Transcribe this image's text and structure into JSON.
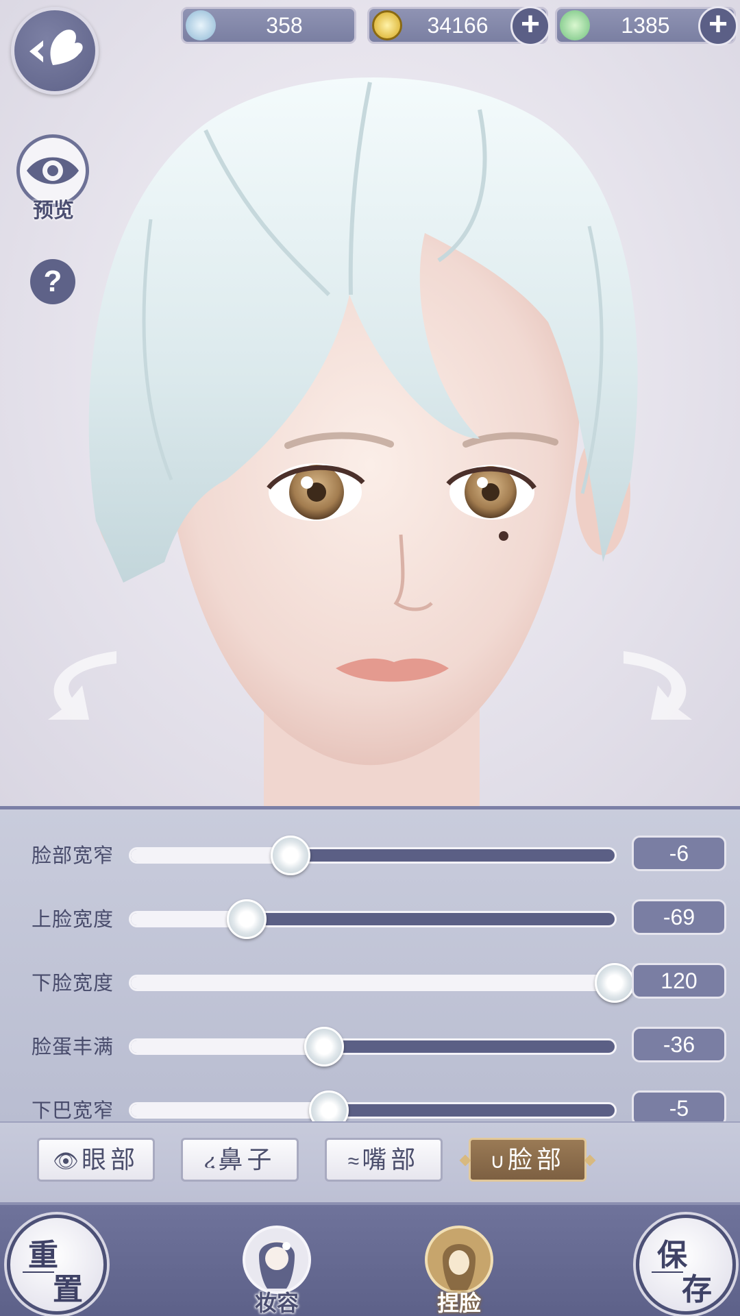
{
  "currencies": [
    {
      "value": "358",
      "icon": "feather-token-icon",
      "has_plus": false
    },
    {
      "value": "34166",
      "icon": "gold-coin-icon",
      "has_plus": true
    },
    {
      "value": "1385",
      "icon": "jade-token-icon",
      "has_plus": true
    }
  ],
  "left_controls": {
    "preview_label": "预览",
    "help_symbol": "?"
  },
  "sliders": [
    {
      "label": "脸部宽窄",
      "value": "-6",
      "level": 0.33
    },
    {
      "label": "上脸宽度",
      "value": "-69",
      "level": 0.24
    },
    {
      "label": "下脸宽度",
      "value": "120",
      "level": 1.0
    },
    {
      "label": "脸蛋丰满",
      "value": "-36",
      "level": 0.4
    },
    {
      "label": "下巴宽窄",
      "value": "-5",
      "level": 0.41
    }
  ],
  "tabs": [
    {
      "glyph": "👁",
      "label": "眼部",
      "active": false
    },
    {
      "glyph": "ረ",
      "label": "鼻子",
      "active": false
    },
    {
      "glyph": "≈",
      "label": "嘴部",
      "active": false
    },
    {
      "glyph": "∪",
      "label": "脸部",
      "active": true
    }
  ],
  "bottom": {
    "reset": {
      "c1": "重",
      "c2": "置"
    },
    "save": {
      "c1": "保",
      "c2": "存"
    },
    "makeup_label": "妆容",
    "face_label": "捏脸"
  },
  "colors": {
    "panel_accent": "#5b5f85",
    "active_tab": "#8a6b48",
    "value_box": "#7a7ea3"
  }
}
